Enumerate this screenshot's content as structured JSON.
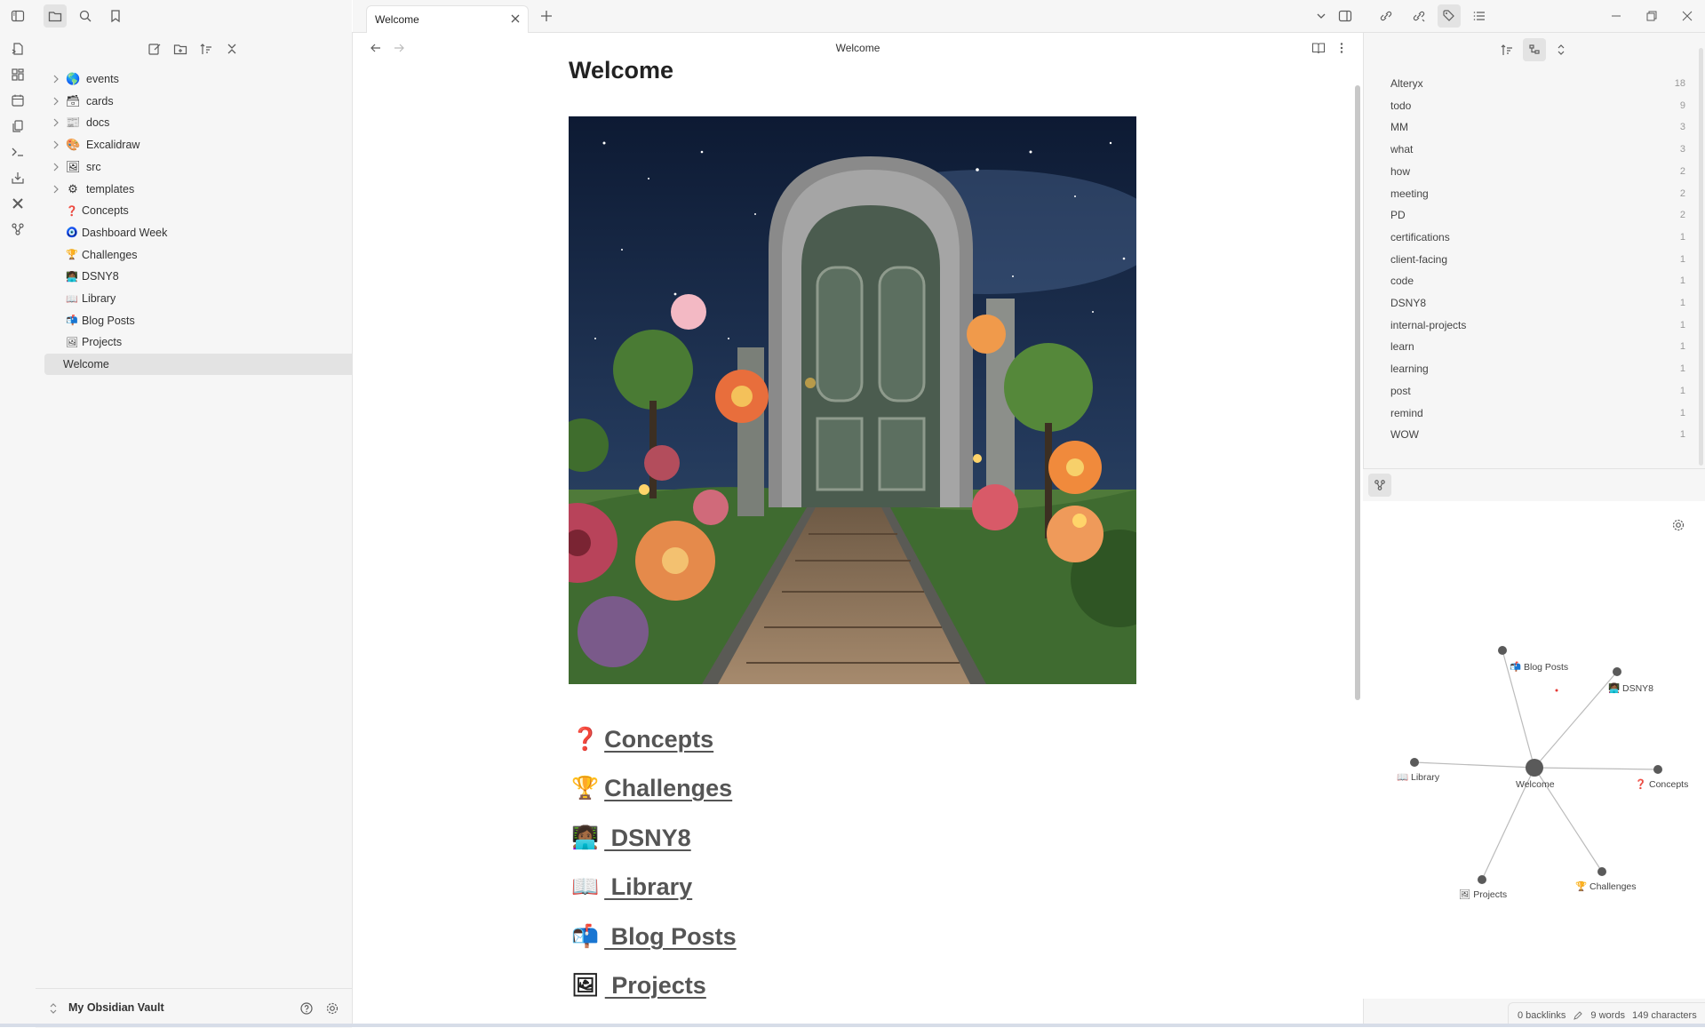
{
  "left_sidebar": {
    "tree": [
      {
        "label": "events",
        "emoji": "🌎",
        "type": "folder"
      },
      {
        "label": "cards",
        "emoji": "🗃",
        "type": "folder"
      },
      {
        "label": "docs",
        "emoji": "📰",
        "type": "folder"
      },
      {
        "label": "Excalidraw",
        "emoji": "🎨",
        "type": "folder"
      },
      {
        "label": "src",
        "emoji": "🖼",
        "type": "folder"
      },
      {
        "label": "templates",
        "emoji": "⚙",
        "type": "folder"
      },
      {
        "label": "Concepts",
        "emoji": "❓",
        "type": "file"
      },
      {
        "label": "Dashboard Week",
        "emoji": "🧿",
        "type": "file"
      },
      {
        "label": "Challenges",
        "emoji": "🏆",
        "type": "file"
      },
      {
        "label": "DSNY8",
        "emoji": "👩🏾‍💻",
        "type": "file"
      },
      {
        "label": "Library",
        "emoji": "📖",
        "type": "file"
      },
      {
        "label": "Blog Posts",
        "emoji": "📬",
        "type": "file"
      },
      {
        "label": "Projects",
        "emoji": "🖼",
        "type": "file"
      },
      {
        "label": "Welcome",
        "emoji": "",
        "type": "file",
        "selected": true
      }
    ],
    "vault_name": "My Obsidian Vault"
  },
  "tabs": [
    {
      "label": "Welcome",
      "active": true
    }
  ],
  "view_header": {
    "title": "Welcome"
  },
  "note": {
    "title": "Welcome",
    "links": [
      {
        "emoji": "❓",
        "label": "Concepts"
      },
      {
        "emoji": "🏆",
        "label": "Challenges"
      },
      {
        "emoji": "👩🏾‍💻",
        "label": " DSNY8"
      },
      {
        "emoji": "📖",
        "label": " Library"
      },
      {
        "emoji": "📬",
        "label": " Blog Posts"
      },
      {
        "emoji": "🖼",
        "label": " Projects"
      }
    ]
  },
  "tags": [
    {
      "name": "Alteryx",
      "count": "18"
    },
    {
      "name": "todo",
      "count": "9"
    },
    {
      "name": "MM",
      "count": "3"
    },
    {
      "name": "what",
      "count": "3"
    },
    {
      "name": "how",
      "count": "2"
    },
    {
      "name": "meeting",
      "count": "2"
    },
    {
      "name": "PD",
      "count": "2"
    },
    {
      "name": "certifications",
      "count": "1"
    },
    {
      "name": "client-facing",
      "count": "1"
    },
    {
      "name": "code",
      "count": "1"
    },
    {
      "name": "DSNY8",
      "count": "1"
    },
    {
      "name": "internal-projects",
      "count": "1"
    },
    {
      "name": "learn",
      "count": "1"
    },
    {
      "name": "learning",
      "count": "1"
    },
    {
      "name": "post",
      "count": "1"
    },
    {
      "name": "remind",
      "count": "1"
    },
    {
      "name": "WOW",
      "count": "1"
    }
  ],
  "graph": {
    "center": "Welcome",
    "nodes": [
      {
        "label": "Blog Posts",
        "emoji": "📬"
      },
      {
        "label": "DSNY8",
        "emoji": "👩🏾‍💻"
      },
      {
        "label": "Library",
        "emoji": "📖"
      },
      {
        "label": "Concepts",
        "emoji": "❓"
      },
      {
        "label": "Projects",
        "emoji": "🖼"
      },
      {
        "label": "Challenges",
        "emoji": "🏆"
      }
    ]
  },
  "status": {
    "backlinks": "0 backlinks",
    "words": "9 words",
    "characters": "149 characters"
  },
  "colors": {
    "accent": "#7f6df2",
    "node": "#5a5a5a",
    "link_text": "#555555"
  }
}
